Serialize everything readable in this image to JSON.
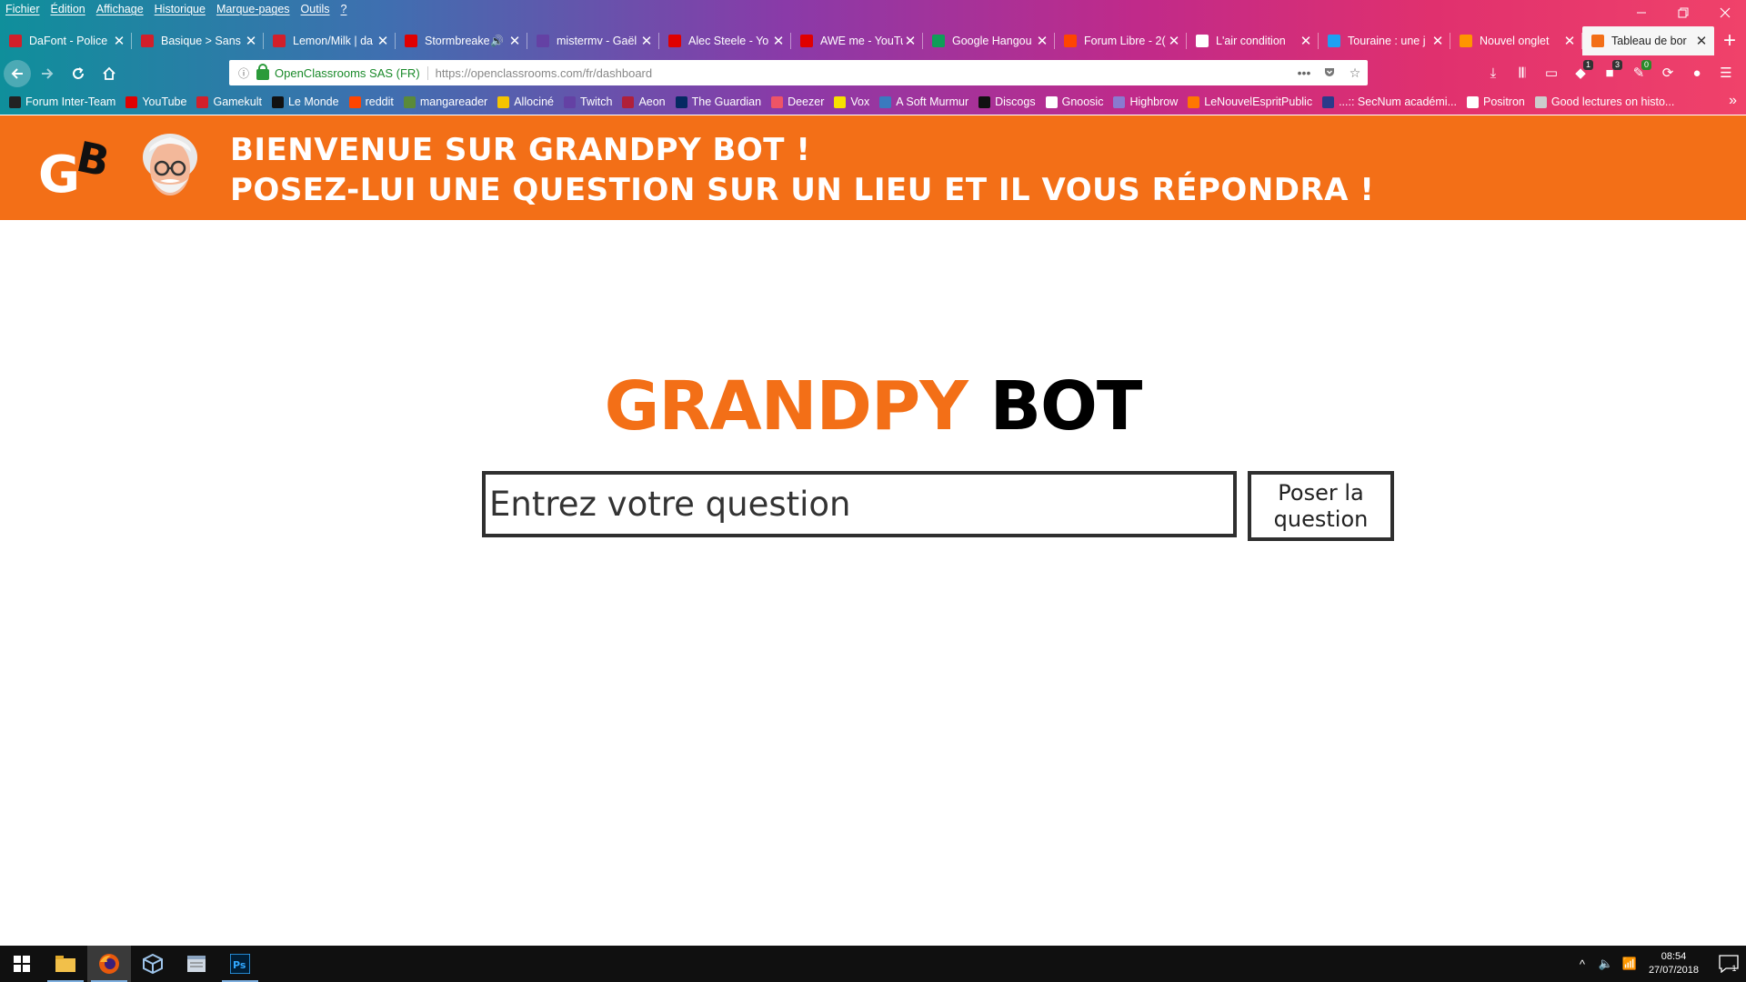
{
  "browser": {
    "menu": [
      "Fichier",
      "Édition",
      "Affichage",
      "Historique",
      "Marque-pages",
      "Outils",
      "?"
    ],
    "tabs": [
      {
        "title": "DaFont - Police",
        "icon_color": "#d21f2a"
      },
      {
        "title": "Basique > Sans",
        "icon_color": "#d21f2a"
      },
      {
        "title": "Lemon/Milk | da",
        "icon_color": "#d21f2a"
      },
      {
        "title": "Stormbreake",
        "icon_color": "#e00000"
      },
      {
        "title": "mistermv - Gaël",
        "icon_color": "#6441a4"
      },
      {
        "title": "Alec Steele - Yo",
        "icon_color": "#e00000"
      },
      {
        "title": "AWE me - YouTu",
        "icon_color": "#e00000"
      },
      {
        "title": "Google Hangou",
        "icon_color": "#0f9d58"
      },
      {
        "title": "Forum Libre - 2(",
        "icon_color": "#ff4500"
      },
      {
        "title": "L'air condition",
        "icon_color": "#ffffff"
      },
      {
        "title": "Touraine : une j",
        "icon_color": "#1da1f2"
      },
      {
        "title": "Nouvel onglet",
        "icon_color": "#ff9500"
      },
      {
        "title": "Tableau de bor",
        "icon_color": "#f36f17"
      }
    ],
    "url_owner": "OpenClassrooms SAS (FR)",
    "url": "https://openclassrooms.com/fr/dashboard",
    "badges": {
      "b1": "1",
      "b2": "3",
      "b3": "0"
    },
    "bookmarks": [
      {
        "label": "Forum Inter-Team",
        "icon_color": "#222222"
      },
      {
        "label": "YouTube",
        "icon_color": "#e00000"
      },
      {
        "label": "Gamekult",
        "icon_color": "#d21f2a"
      },
      {
        "label": "Le Monde",
        "icon_color": "#111111"
      },
      {
        "label": "reddit",
        "icon_color": "#ff4500"
      },
      {
        "label": "mangareader",
        "icon_color": "#5a8a3a"
      },
      {
        "label": "Allociné",
        "icon_color": "#f5c400"
      },
      {
        "label": "Twitch",
        "icon_color": "#6441a4"
      },
      {
        "label": "Aeon",
        "icon_color": "#b0203a"
      },
      {
        "label": "The Guardian",
        "icon_color": "#052962"
      },
      {
        "label": "Deezer",
        "icon_color": "#ef5466"
      },
      {
        "label": "Vox",
        "icon_color": "#f7e000"
      },
      {
        "label": "A Soft Murmur",
        "icon_color": "#3a7abf"
      },
      {
        "label": "Discogs",
        "icon_color": "#111111"
      },
      {
        "label": "Gnoosic",
        "icon_color": "#ffffff"
      },
      {
        "label": "Highbrow",
        "icon_color": "#8a7ad0"
      },
      {
        "label": "LeNouvelEspritPublic",
        "icon_color": "#ff7700"
      },
      {
        "label": "...:: SecNum académi...",
        "icon_color": "#2a3a8a"
      },
      {
        "label": "Positron",
        "icon_color": "#ffffff"
      },
      {
        "label": "Good lectures on histo...",
        "icon_color": "#cccccc"
      }
    ]
  },
  "page": {
    "banner_line1": "BIENVENUE SUR GRANDPY BOT !",
    "banner_line2": "POSEZ-LUI UNE QUESTION SUR UN LIEU ET IL VOUS RÉPONDRA !",
    "logo_letters": "GB",
    "title_part1": "GRANDPY",
    "title_part2": "BOT",
    "input_placeholder": "Entrez votre question",
    "button_label": "Poser la question",
    "brand_color": "#f36f17"
  },
  "taskbar": {
    "apps": [
      "windows-start-icon",
      "file-explorer-icon",
      "firefox-icon",
      "virtualbox-icon",
      "notepad-icon",
      "photoshop-icon"
    ],
    "time": "08:54",
    "date": "27/07/2018",
    "notification_count": "1"
  }
}
